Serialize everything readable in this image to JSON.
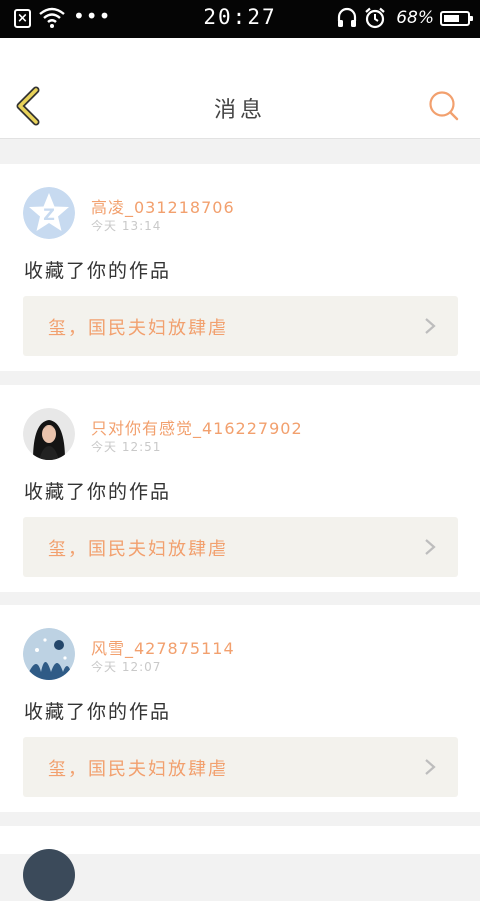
{
  "status_bar": {
    "time": "20:27",
    "battery_percent": "68%",
    "battery_level": 0.68,
    "dots": "•••"
  },
  "header": {
    "title": "消息"
  },
  "messages": [
    {
      "username": "高凌_031218706",
      "time": "今天 13:14",
      "action": "收藏了你的作品",
      "work_title": "玺，国民夫妇放肆虐",
      "avatar": "qq-default-avatar"
    },
    {
      "username": "只对你有感觉_416227902",
      "time": "今天 12:51",
      "action": "收藏了你的作品",
      "work_title": "玺，国民夫妇放肆虐",
      "avatar": "girl-photo-avatar"
    },
    {
      "username": "风雪_427875114",
      "time": "今天 12:07",
      "action": "收藏了你的作品",
      "work_title": "玺，国民夫妇放肆虐",
      "avatar": "winter-scene-avatar"
    }
  ],
  "colors": {
    "accent": "#f2a06e",
    "back_arrow": "#e2c84a",
    "work_bg": "#f3f2ed"
  }
}
